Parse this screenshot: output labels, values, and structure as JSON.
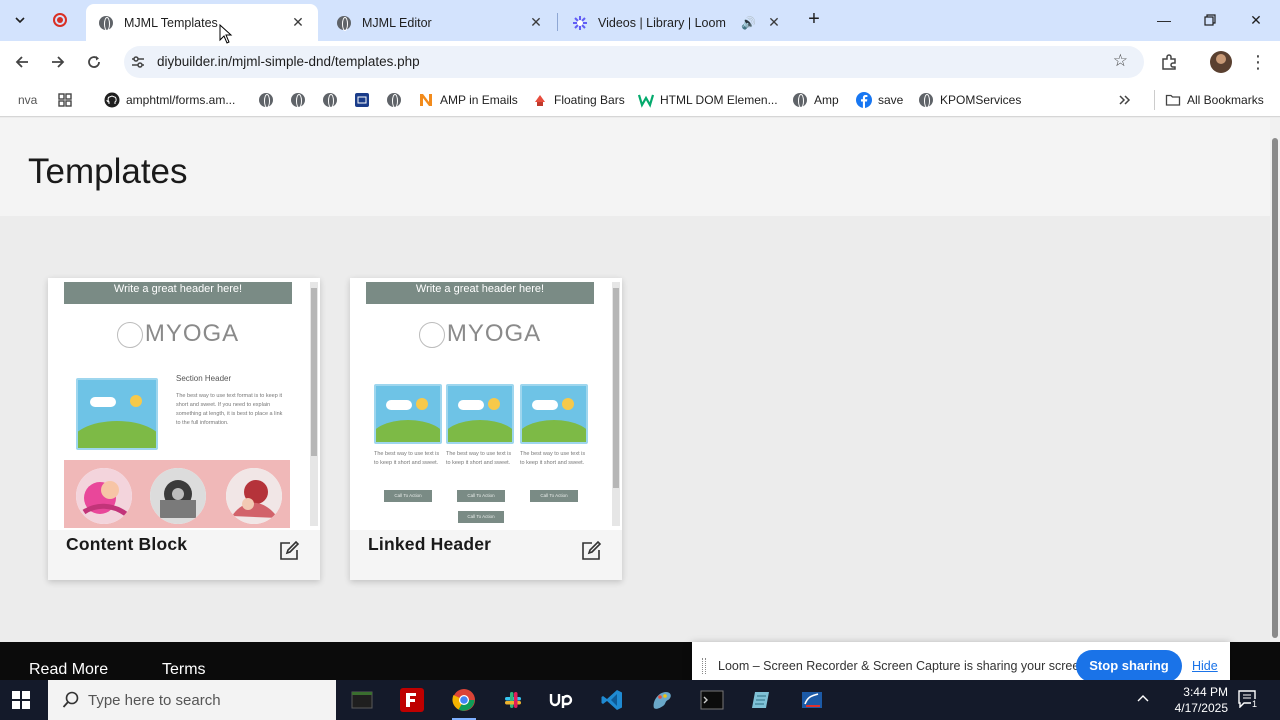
{
  "browser": {
    "tabs": [
      {
        "title": "MJML Templates",
        "active": true
      },
      {
        "title": "MJML Editor",
        "active": false
      },
      {
        "title": "Videos | Library | Loom",
        "active": false
      }
    ],
    "url": "diybuilder.in/mjml-simple-dnd/templates.php"
  },
  "bookmarks": {
    "items": [
      {
        "label": "nva"
      },
      {
        "label": "amphtml/forms.am..."
      },
      {
        "label": "AMP in Emails"
      },
      {
        "label": "Floating Bars"
      },
      {
        "label": "HTML DOM Elemen..."
      },
      {
        "label": "Amp"
      },
      {
        "label": "save"
      },
      {
        "label": "KPOMServices"
      }
    ],
    "all_bookmarks": "All Bookmarks"
  },
  "page": {
    "title": "Templates",
    "cards": [
      {
        "name": "Content Block",
        "preview": {
          "header": "Write a great header here!",
          "logo": "MYOGA",
          "section_header": "Section Header",
          "body": "The best way to use text format is to keep it short and sweet. If you need to explain something at length, it is best to place a link to the full information."
        }
      },
      {
        "name": "Linked Header",
        "preview": {
          "header": "Write a great header here!",
          "logo": "MYOGA",
          "column_text": "The best way to use text is to keep it short and sweet.",
          "button_text": "Call To Action"
        }
      }
    ],
    "footer": {
      "read_more": "Read More",
      "terms": "Terms"
    }
  },
  "loom": {
    "message": "Loom – Screen Recorder & Screen Capture is sharing your screen.",
    "stop_label": "Stop sharing",
    "hide_label": "Hide"
  },
  "taskbar": {
    "search_placeholder": "Type here to search",
    "time": "3:44 PM",
    "date": "4/17/2025",
    "notification_count": "1"
  },
  "colors": {
    "tabstrip": "#d3e3fd",
    "loom_button": "#1a73e8",
    "taskbar": "#141a2a",
    "template_header": "#7a8b85"
  }
}
